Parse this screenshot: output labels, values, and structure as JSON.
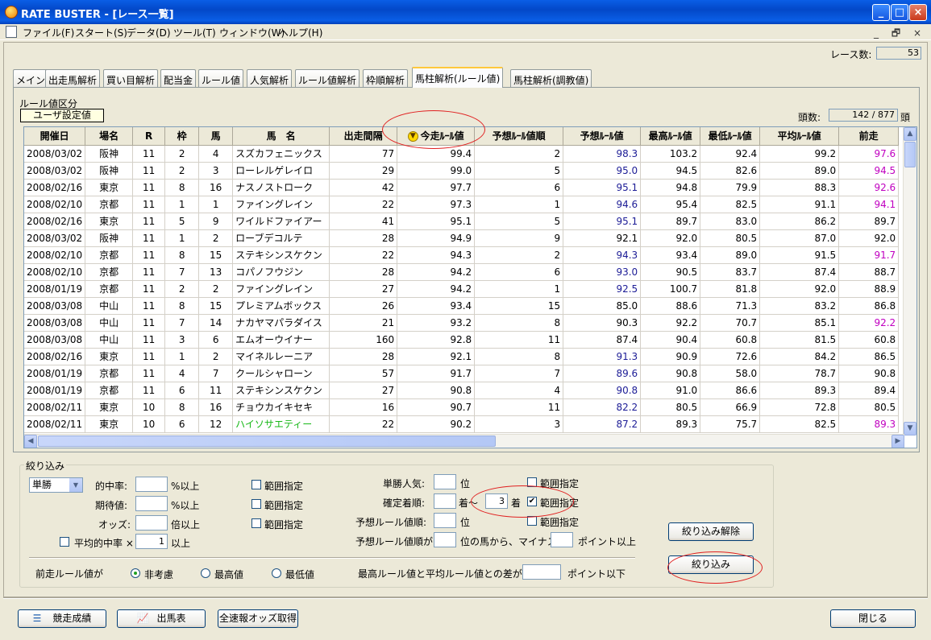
{
  "window": {
    "title": "RATE BUSTER - [レース一覧]"
  },
  "menu": [
    "ファイル(F)",
    "スタート(S)",
    "データ(D)",
    "ツール(T)",
    "ウィンドウ(W)",
    "ヘルプ(H)"
  ],
  "race_count": {
    "label": "レース数:",
    "value": "53"
  },
  "tabs": [
    "メイン",
    "出走馬解析",
    "買い目解析",
    "配当金",
    "ルール値",
    "人気解析",
    "ルール値解析",
    "枠順解析",
    "馬柱解析(ルール値)",
    "馬柱解析(調教値)"
  ],
  "active_tab": "馬柱解析(ルール値)",
  "rule_category": {
    "label": "ルール値区分",
    "value": "ユーザ設定値"
  },
  "head_count": {
    "label": "頭数:",
    "value": "142 / 877",
    "unit": "頭"
  },
  "grid": {
    "columns": [
      "開催日",
      "場名",
      "R",
      "枠",
      "馬",
      "馬　名",
      "出走間隔",
      "今走ﾙｰﾙ値",
      "予想ﾙｰﾙ値順",
      "予想ﾙｰﾙ値",
      "最高ﾙｰﾙ値",
      "最低ﾙｰﾙ値",
      "平均ﾙｰﾙ値",
      "前走"
    ],
    "sort_icon": "sort-descending-icon",
    "rows": [
      [
        "2008/03/02",
        "阪神",
        "11",
        "2",
        "4",
        "スズカフェニックス",
        "77",
        "99.4",
        "2",
        "98.3",
        "103.2",
        "92.4",
        "99.2",
        "97.6"
      ],
      [
        "2008/03/02",
        "阪神",
        "11",
        "2",
        "3",
        "ローレルゲレイロ",
        "29",
        "99.0",
        "5",
        "95.0",
        "94.5",
        "82.6",
        "89.0",
        "94.5"
      ],
      [
        "2008/02/16",
        "東京",
        "11",
        "8",
        "16",
        "ナスノストローク",
        "42",
        "97.7",
        "6",
        "95.1",
        "94.8",
        "79.9",
        "88.3",
        "92.6"
      ],
      [
        "2008/02/10",
        "京都",
        "11",
        "1",
        "1",
        "ファイングレイン",
        "22",
        "97.3",
        "1",
        "94.6",
        "95.4",
        "82.5",
        "91.1",
        "94.1"
      ],
      [
        "2008/02/16",
        "東京",
        "11",
        "5",
        "9",
        "ワイルドファイアー",
        "41",
        "95.1",
        "5",
        "95.1",
        "89.7",
        "83.0",
        "86.2",
        "89.7"
      ],
      [
        "2008/03/02",
        "阪神",
        "11",
        "1",
        "2",
        "ローブデコルテ",
        "28",
        "94.9",
        "9",
        "92.1",
        "92.0",
        "80.5",
        "87.0",
        "92.0"
      ],
      [
        "2008/02/10",
        "京都",
        "11",
        "8",
        "15",
        "ステキシンスケクン",
        "22",
        "94.3",
        "2",
        "94.3",
        "93.4",
        "89.0",
        "91.5",
        "91.7"
      ],
      [
        "2008/02/10",
        "京都",
        "11",
        "7",
        "13",
        "コパノフウジン",
        "28",
        "94.2",
        "6",
        "93.0",
        "90.5",
        "83.7",
        "87.4",
        "88.7"
      ],
      [
        "2008/01/19",
        "京都",
        "11",
        "2",
        "2",
        "ファイングレイン",
        "27",
        "94.2",
        "1",
        "92.5",
        "100.7",
        "81.8",
        "92.0",
        "88.9"
      ],
      [
        "2008/03/08",
        "中山",
        "11",
        "8",
        "15",
        "プレミアムボックス",
        "26",
        "93.4",
        "15",
        "85.0",
        "88.6",
        "71.3",
        "83.2",
        "86.8"
      ],
      [
        "2008/03/08",
        "中山",
        "11",
        "7",
        "14",
        "ナカヤマパラダイス",
        "21",
        "93.2",
        "8",
        "90.3",
        "92.2",
        "70.7",
        "85.1",
        "92.2"
      ],
      [
        "2008/03/08",
        "中山",
        "11",
        "3",
        "6",
        "エムオーウイナー",
        "160",
        "92.8",
        "11",
        "87.4",
        "90.4",
        "60.8",
        "81.5",
        "60.8"
      ],
      [
        "2008/02/16",
        "東京",
        "11",
        "1",
        "2",
        "マイネルレーニア",
        "28",
        "92.1",
        "8",
        "91.3",
        "90.9",
        "72.6",
        "84.2",
        "86.5"
      ],
      [
        "2008/01/19",
        "京都",
        "11",
        "4",
        "7",
        "クールシャローン",
        "57",
        "91.7",
        "7",
        "89.6",
        "90.8",
        "58.0",
        "78.7",
        "90.8"
      ],
      [
        "2008/01/19",
        "京都",
        "11",
        "6",
        "11",
        "ステキシンスケクン",
        "27",
        "90.8",
        "4",
        "90.8",
        "91.0",
        "86.6",
        "89.3",
        "89.4"
      ],
      [
        "2008/02/11",
        "東京",
        "10",
        "8",
        "16",
        "チョウカイキセキ",
        "16",
        "90.7",
        "11",
        "82.2",
        "80.5",
        "66.9",
        "72.8",
        "80.5"
      ],
      [
        "2008/02/11",
        "東京",
        "10",
        "6",
        "12",
        "ハイソサエティー",
        "22",
        "90.2",
        "3",
        "87.2",
        "89.3",
        "75.7",
        "82.5",
        "89.3"
      ]
    ],
    "blue_rows_pred": [
      0,
      1,
      2,
      3,
      4,
      6,
      7,
      8,
      12,
      13,
      14,
      15,
      16
    ],
    "mag_rows_prev": [
      0,
      1,
      2,
      3,
      6,
      10,
      16
    ],
    "green_name_rows": [
      16
    ]
  },
  "filter": {
    "group_label": "絞り込み",
    "bet_type": "単勝",
    "hit_rate": {
      "label": "的中率:",
      "suffix": "%以上",
      "value": ""
    },
    "expected": {
      "label": "期待値:",
      "suffix": "%以上",
      "value": ""
    },
    "odds": {
      "label": "オッズ:",
      "suffix": "倍以上",
      "value": ""
    },
    "avg_hit": {
      "label": "平均的中率 ×",
      "value": "1",
      "suffix": "以上",
      "checked": false
    },
    "range_label": "範囲指定",
    "win_pop": {
      "label": "単勝人気:",
      "suffix": "位",
      "value": "",
      "range_checked": false
    },
    "finish": {
      "label": "確定着順:",
      "from_suffix": "着～",
      "value_to": "3",
      "to_suffix": "着",
      "range_checked": true
    },
    "pred_rank": {
      "label": "予想ルール値順:",
      "suffix": "位",
      "value": "",
      "range_checked": false
    },
    "pred_rank_diff": {
      "label": "予想ルール値順が",
      "mid": "位の馬から、マイナス",
      "suffix": "ポイント以上"
    },
    "prev_rule": {
      "label": "前走ルール値が",
      "options": [
        "非考慮",
        "最高値",
        "最低値"
      ],
      "selected": "非考慮"
    },
    "max_avg_diff": {
      "label": "最高ルール値と平均ルール値との差が",
      "suffix": "ポイント以下"
    },
    "clear_button": "絞り込み解除",
    "apply_button": "絞り込み"
  },
  "bottom": {
    "results_button": "競走成績",
    "entries_button": "出馬表",
    "odds_button": "全速報オッズ取得",
    "close_button": "閉じる"
  },
  "colors": {
    "title_bar": "#0a5ee6",
    "pred_value_blue": "#1c1c96",
    "prev_magenta": "#c000c0",
    "name_green": "#18b818",
    "annotation_red": "#e02020"
  }
}
